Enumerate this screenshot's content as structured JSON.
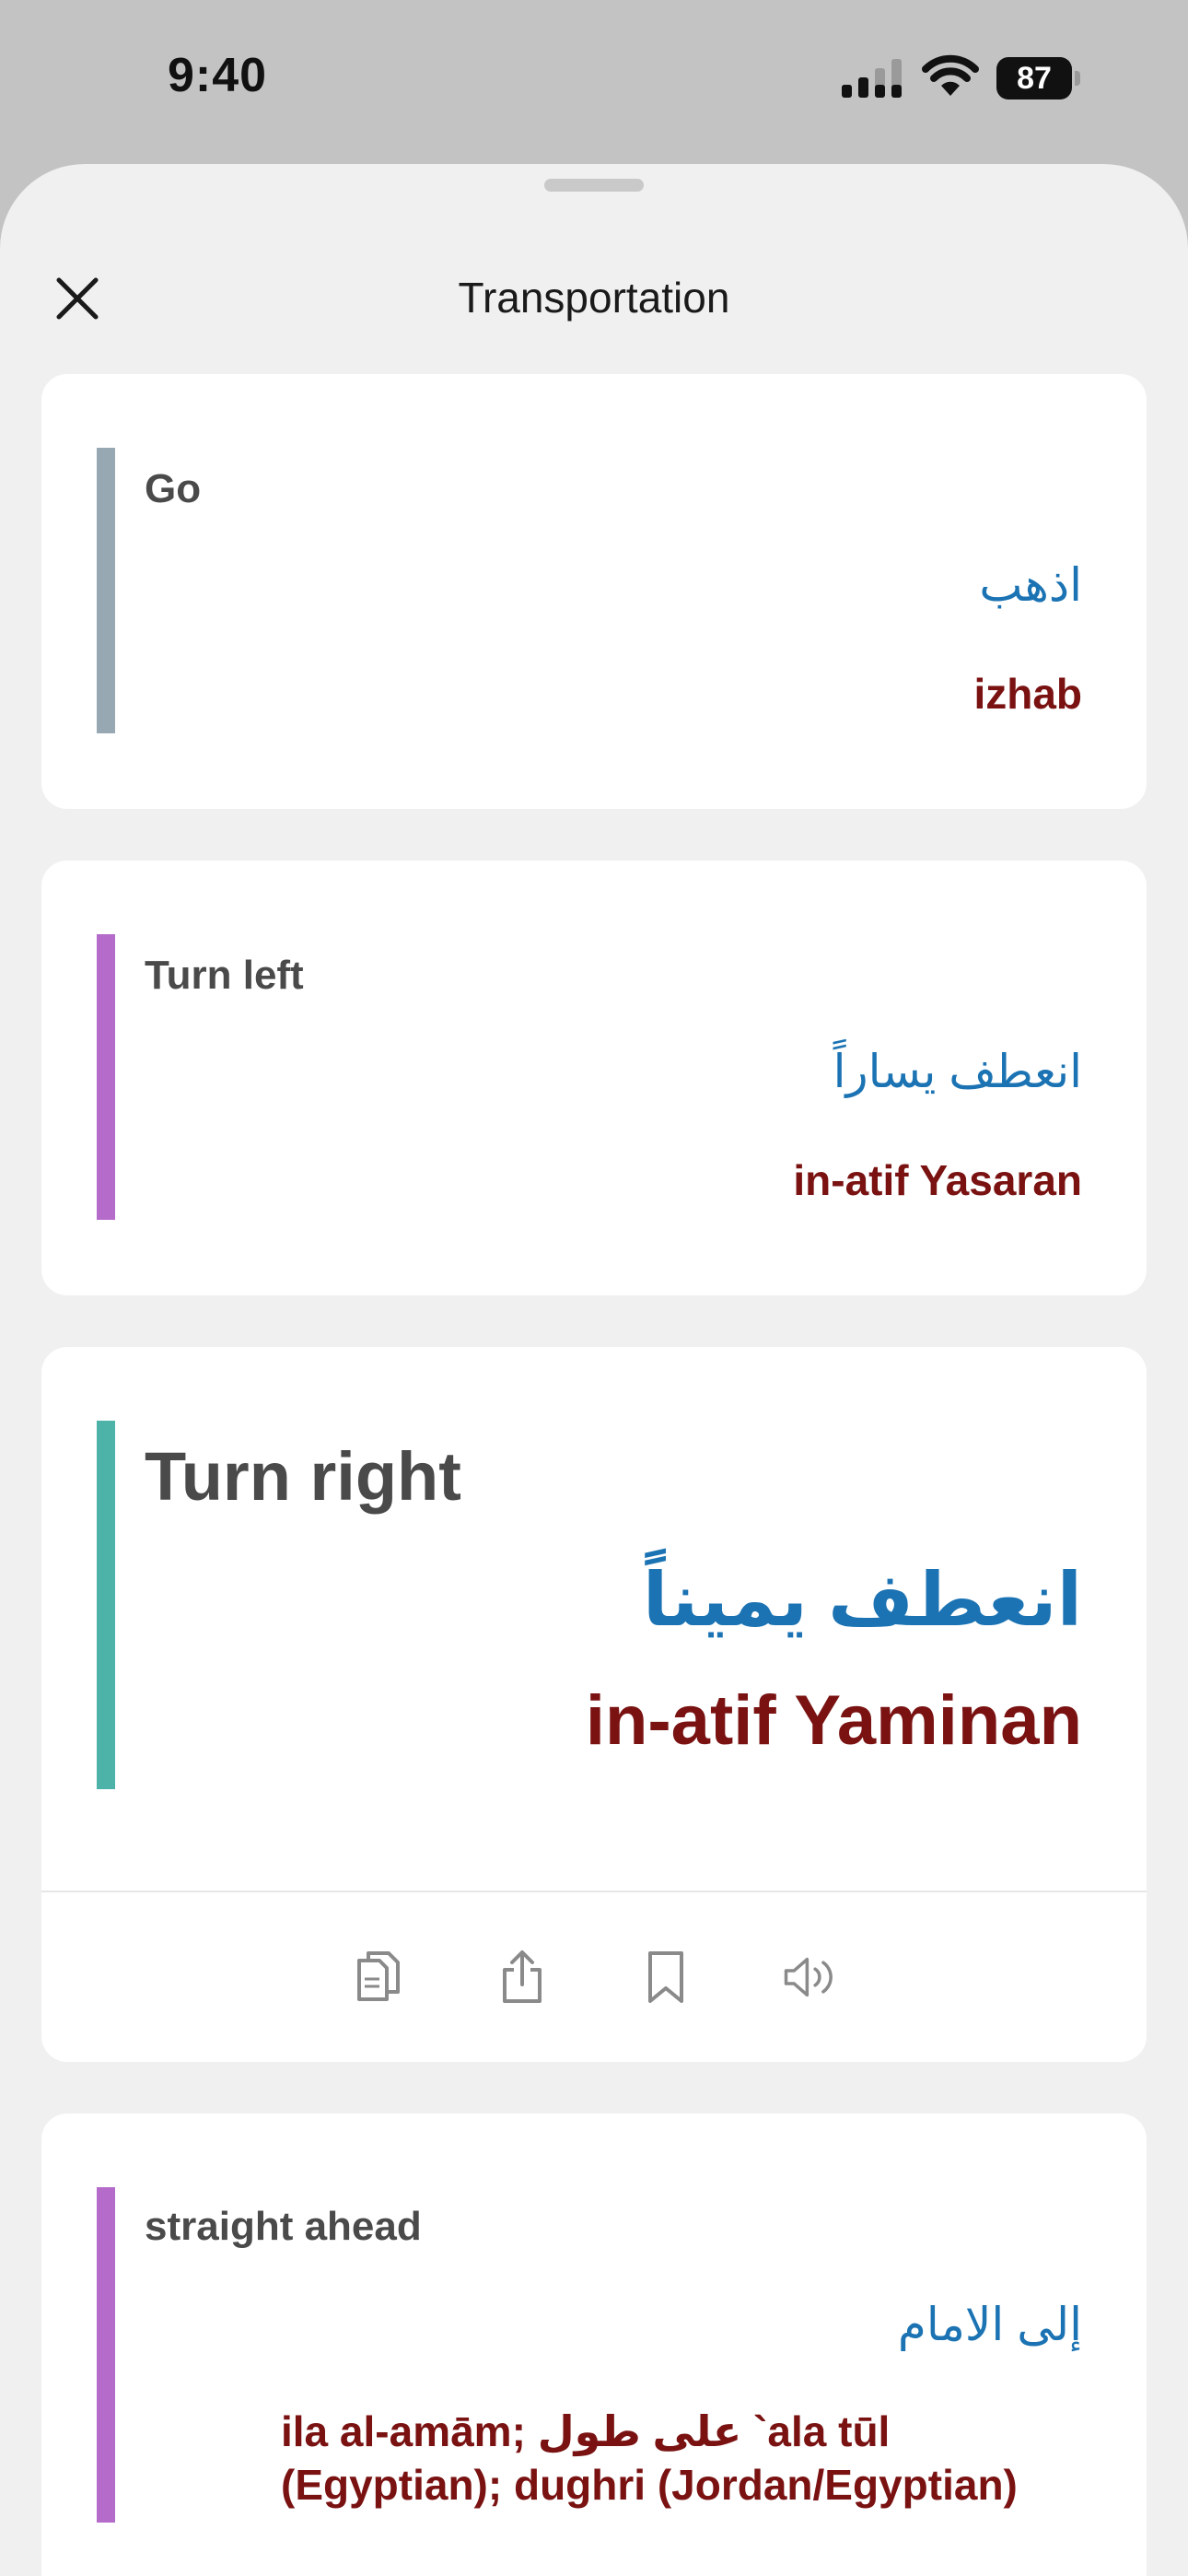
{
  "status_bar": {
    "time": "9:40",
    "battery": "87"
  },
  "sheet": {
    "title": "Transportation"
  },
  "phrases": [
    {
      "english": "Go",
      "arabic": "اذهب",
      "transliteration": "izhab",
      "accent": "#97a8b3"
    },
    {
      "english": "Turn left",
      "arabic": "انعطف يساراً",
      "transliteration": "in-atif Yasaran",
      "accent": "#b46bc9"
    },
    {
      "english": "Turn right",
      "arabic": "انعطف يميناً",
      "transliteration": "in-atif Yaminan",
      "accent": "#4db3a9"
    },
    {
      "english": "straight ahead",
      "arabic": "إلى الامام",
      "transliteration": "ila al-amām; على طول `ala tūl (Egyptian); dughri (Jordan/Egyptian)",
      "accent": "#b46bc9"
    }
  ],
  "actions": [
    "copy-icon",
    "share-icon",
    "bookmark-icon",
    "speaker-icon"
  ],
  "colors": {
    "arabic": "#1b73b3",
    "transliteration": "#7a1212"
  }
}
